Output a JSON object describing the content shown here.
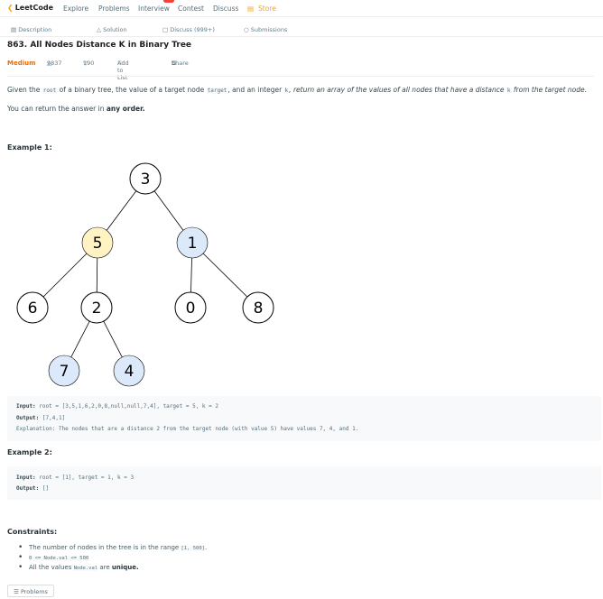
{
  "topnav": {
    "logo": "LeetCode",
    "items": [
      "Explore",
      "Problems",
      "Interview",
      "Contest",
      "Discuss",
      "Store"
    ]
  },
  "tabs": {
    "description": "Description",
    "solution": "Solution",
    "discuss": "Discuss (999+)",
    "submissions": "Submissions"
  },
  "problem": {
    "title": "863. All Nodes Distance K in Binary Tree",
    "difficulty": "Medium",
    "likes": "9837",
    "dislikes": "190",
    "add_to_list": "Add to List",
    "share": "Share"
  },
  "description": {
    "p1_a": "Given the ",
    "p1_code1": "root",
    "p1_b": " of a binary tree, the value of a target node ",
    "p1_code2": "target",
    "p1_c": ", and an integer ",
    "p1_code3": "k",
    "p1_d": ", return an array of the values of all nodes that have a distance ",
    "p1_code4": "k",
    "p1_e": " from the target node.",
    "p2_a": "You can return the answer in ",
    "p2_b": "any order."
  },
  "example1": {
    "title": "Example 1:",
    "tree_nodes": [
      "3",
      "5",
      "1",
      "6",
      "2",
      "0",
      "8",
      "7",
      "4"
    ],
    "input_label": "Input:",
    "input": " root = [3,5,1,6,2,0,8,null,null,7,4], target = 5, k = 2",
    "output_label": "Output:",
    "output": " [7,4,1]",
    "explanation": "Explanation: The nodes that are a distance 2 from the target node (with value 5) have values 7, 4, and 1."
  },
  "example2": {
    "title": "Example 2:",
    "input_label": "Input:",
    "input": " root = [1], target = 1, k = 3",
    "output_label": "Output:",
    "output": " []"
  },
  "constraints": {
    "title": "Constraints:",
    "c1_text": "The number of nodes in the tree is in the range ",
    "c1_code": "[1, 500]",
    "c1_end": ".",
    "c2_code": "0 <= Node.val <= 500",
    "c3_a": "All the values ",
    "c3_code": "Node.val",
    "c3_b": " are ",
    "c3_c": "unique."
  },
  "bottom": {
    "problems_label": "Problems"
  },
  "colors": {
    "target_fill": "#fff3c4",
    "result_fill": "#dce9fb",
    "plain_fill": "#ffffff",
    "difficulty": "#ef6c00",
    "store": "#f89f1b"
  }
}
